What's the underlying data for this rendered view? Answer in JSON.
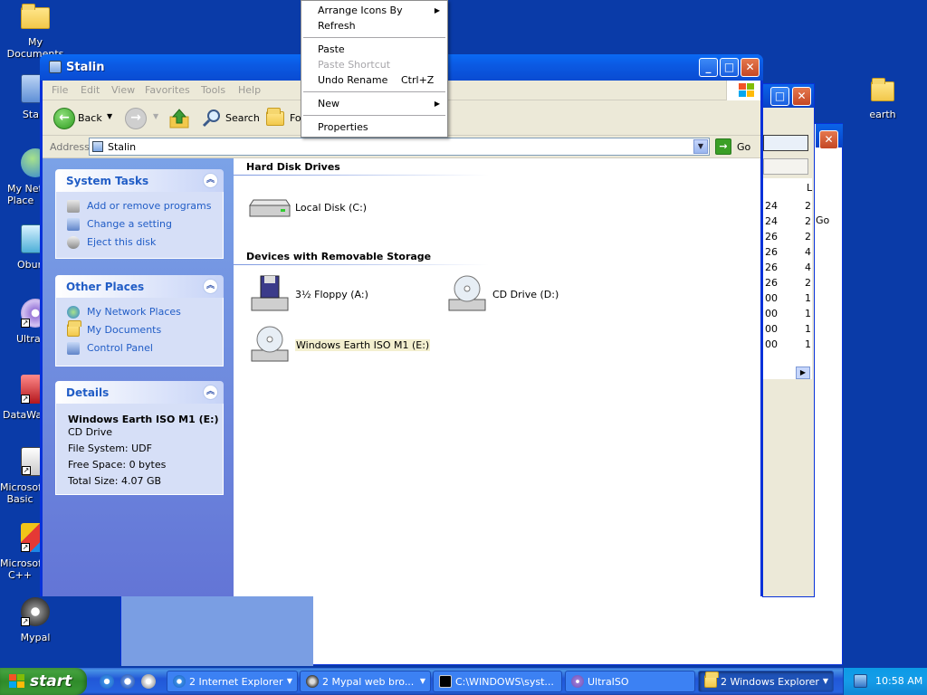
{
  "desktop": {
    "icons": [
      {
        "label": "My Documents"
      },
      {
        "label": "Stal"
      },
      {
        "label": "My Netw\nPlace"
      },
      {
        "label": "Obur"
      },
      {
        "label": "UltraI"
      },
      {
        "label": "DataWa"
      },
      {
        "label": "Microsof\nBasic"
      },
      {
        "label": "Microsof\nC++"
      },
      {
        "label": "Mypal"
      },
      {
        "label": "earth"
      }
    ]
  },
  "background_window": {
    "list_col_header": "L",
    "go_label": "Go",
    "list_rows": [
      {
        "a": "24",
        "b": "2"
      },
      {
        "a": "24",
        "b": "2"
      },
      {
        "a": "26",
        "b": "2"
      },
      {
        "a": "26",
        "b": "4"
      },
      {
        "a": "26",
        "b": "4"
      },
      {
        "a": "26",
        "b": "2"
      },
      {
        "a": "00",
        "b": "1"
      },
      {
        "a": "00",
        "b": "1"
      },
      {
        "a": "00",
        "b": "1"
      },
      {
        "a": "00",
        "b": "1"
      }
    ]
  },
  "window": {
    "title": "Stalin",
    "menu": [
      "File",
      "Edit",
      "View",
      "Favorites",
      "Tools",
      "Help"
    ],
    "toolbar": {
      "back": "Back",
      "search": "Search",
      "folders": "Fo"
    },
    "address": {
      "label": "Address",
      "value": "Stalin",
      "go": "Go"
    }
  },
  "tasks": {
    "system_tasks": {
      "title": "System Tasks",
      "items": [
        "Add or remove programs",
        "Change a setting",
        "Eject this disk"
      ]
    },
    "other_places": {
      "title": "Other Places",
      "items": [
        "My Network Places",
        "My Documents",
        "Control Panel"
      ]
    },
    "details": {
      "title": "Details",
      "name": "Windows Earth ISO M1 (E:)",
      "type": "CD Drive",
      "filesystem": "File System: UDF",
      "free": "Free Space: 0 bytes",
      "total": "Total Size: 4.07 GB"
    }
  },
  "content": {
    "groups": [
      {
        "title": "Hard Disk Drives"
      },
      {
        "title": "Devices with Removable Storage"
      }
    ],
    "items": [
      {
        "label": "Local Disk (C:)"
      },
      {
        "label": "3½ Floppy (A:)"
      },
      {
        "label": "CD Drive (D:)"
      },
      {
        "label": "Windows Earth ISO M1 (E:)"
      }
    ]
  },
  "context_menu": {
    "items": [
      {
        "label": "Arrange Icons By",
        "submenu": true
      },
      {
        "label": "Refresh"
      },
      {
        "label": "Paste"
      },
      {
        "label": "Paste Shortcut",
        "disabled": true
      },
      {
        "label": "Undo Rename",
        "shortcut": "Ctrl+Z"
      },
      {
        "label": "New",
        "submenu": true
      },
      {
        "label": "Properties"
      }
    ]
  },
  "taskbar": {
    "start": "start",
    "tasks": [
      {
        "label": "2 Internet Explorer"
      },
      {
        "label": "2 Mypal web bro..."
      },
      {
        "label": "C:\\WINDOWS\\syst..."
      },
      {
        "label": "UltraISO"
      },
      {
        "label": "2 Windows Explorer"
      }
    ],
    "clock": "10:58 AM"
  },
  "colors": {
    "desktop": "#0a3ba8",
    "titlebar": "#0a5ae3",
    "link": "#215dc6",
    "start": "#3c9c37"
  }
}
